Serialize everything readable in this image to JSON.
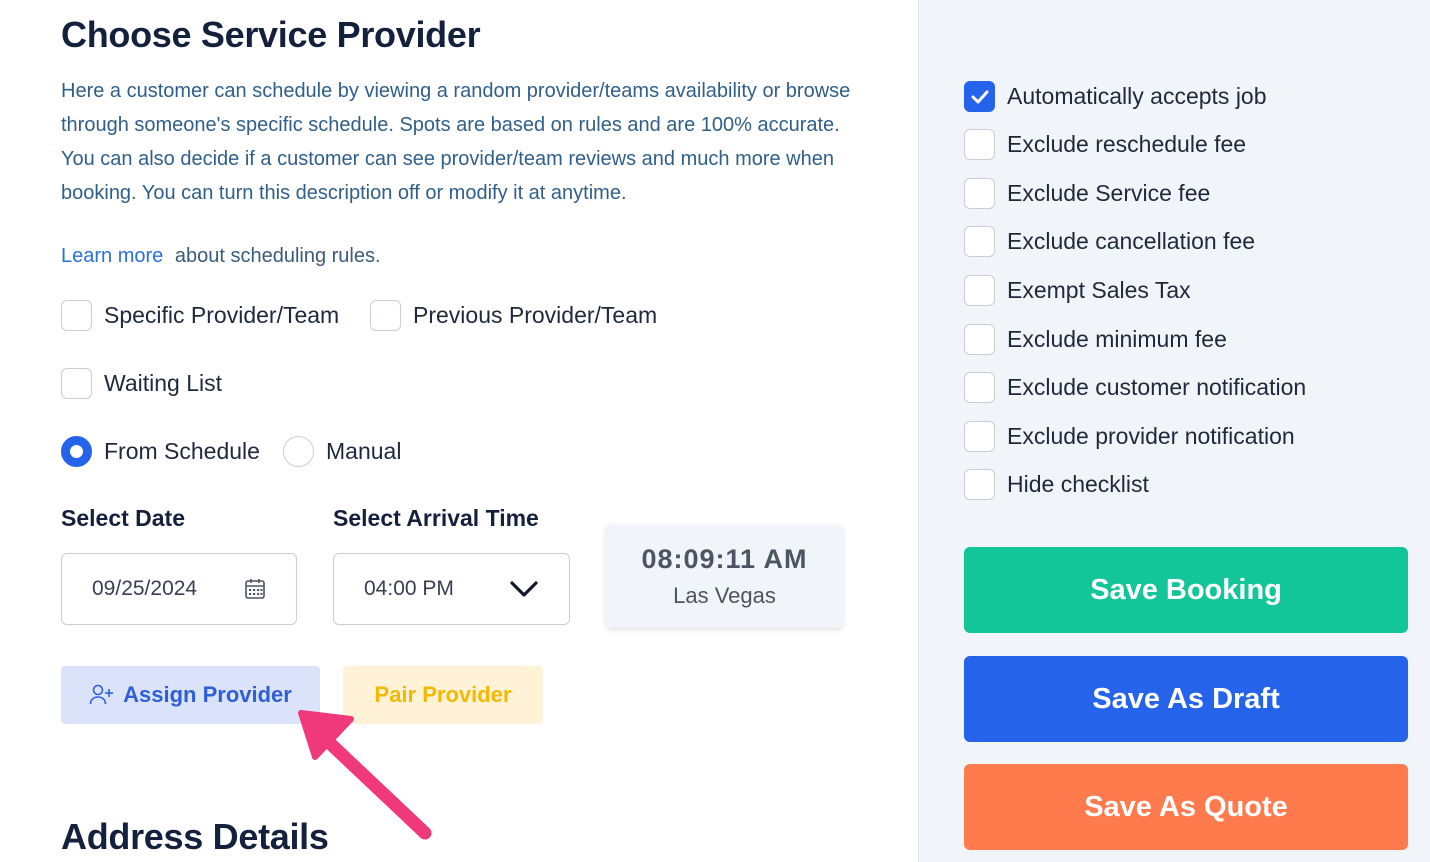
{
  "header": {
    "title": "Choose Service Provider",
    "description": "Here a customer can schedule by viewing a random provider/teams availability or browse through someone's specific schedule. Spots are based on rules and are 100% accurate. You can also decide if a customer can see provider/team reviews and much more when booking. You can turn this description off or modify it at anytime.",
    "learn_more_link": "Learn more",
    "learn_more_suffix": "about scheduling rules."
  },
  "provider_options": {
    "specific": {
      "label": "Specific Provider/Team",
      "checked": false
    },
    "previous": {
      "label": "Previous Provider/Team",
      "checked": false
    },
    "waiting": {
      "label": "Waiting List",
      "checked": false
    }
  },
  "schedule_mode": {
    "from_schedule": {
      "label": "From Schedule",
      "selected": true
    },
    "manual": {
      "label": "Manual",
      "selected": false
    }
  },
  "date": {
    "label": "Select Date",
    "value": "09/25/2024",
    "icon": "calendar-icon"
  },
  "arrival": {
    "label": "Select Arrival Time",
    "value": "04:00 PM",
    "icon": "chevron-down-icon"
  },
  "clock": {
    "time": "08:09:11 AM",
    "city": "Las Vegas"
  },
  "actions": {
    "assign_label": "Assign Provider",
    "pair_label": "Pair Provider"
  },
  "address_section_title": "Address Details",
  "settings": [
    {
      "label": "Automatically accepts job",
      "checked": true
    },
    {
      "label": "Exclude reschedule fee",
      "checked": false
    },
    {
      "label": "Exclude Service fee",
      "checked": false
    },
    {
      "label": "Exclude cancellation fee",
      "checked": false
    },
    {
      "label": "Exempt Sales Tax",
      "checked": false
    },
    {
      "label": "Exclude minimum fee",
      "checked": false
    },
    {
      "label": "Exclude customer notification",
      "checked": false
    },
    {
      "label": "Exclude provider notification",
      "checked": false
    },
    {
      "label": "Hide checklist",
      "checked": false
    }
  ],
  "buttons": {
    "save_booking": {
      "label": "Save Booking",
      "color": "#12c69a"
    },
    "save_draft": {
      "label": "Save As Draft",
      "color": "#2563eb"
    },
    "save_quote": {
      "label": "Save As Quote",
      "color": "#ff7a4d"
    }
  },
  "colors": {
    "accent": "#2563eb",
    "annotation_arrow": "#f0397a"
  }
}
